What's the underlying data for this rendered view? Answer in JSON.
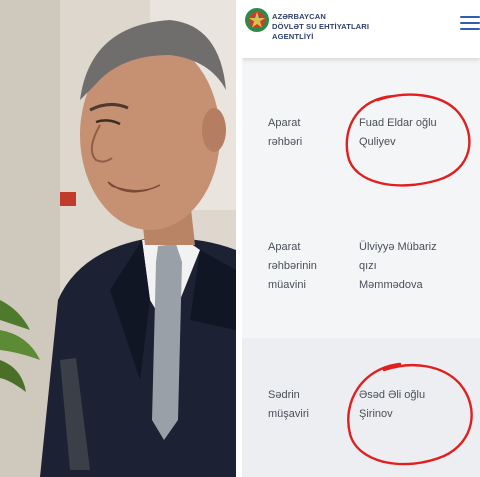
{
  "header": {
    "agency_name_lines": [
      "AZƏRBAYCAN",
      "DÖVLƏT SU EHTİYATLARI",
      "AGENTLİYİ"
    ],
    "menu_icon": "hamburger-menu-icon",
    "emblem_icon": "azerbaijan-emblem-icon",
    "accent_color": "#2f5fb3"
  },
  "rows": [
    {
      "label_lines": [
        "Aparat",
        "rəhbəri"
      ],
      "value_lines": [
        "Fuad Eldar oğlu",
        "Quliyev"
      ]
    },
    {
      "label_lines": [
        "Aparat",
        "rəhbərinin",
        "müavini"
      ],
      "value_lines": [
        "Ülviyyə Mübariz",
        "qızı",
        "Məmmədova"
      ]
    },
    {
      "label_lines": [
        "Sədrin",
        "müşaviri"
      ],
      "value_lines": [
        "Əsəd Əli oğlu",
        "Şirinov"
      ]
    }
  ],
  "annotation_color": "#e01f1f"
}
